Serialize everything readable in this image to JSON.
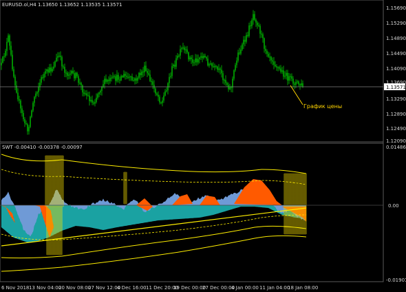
{
  "window": {
    "symbol_info": "EURUSD.ol,H4  1.13650 1.13652 1.13535 1.13571",
    "annotation": "График цены"
  },
  "colors": {
    "background": "#000000",
    "bull_candle": "#00c800",
    "price_marker_bg": "#ffffff",
    "annotation": "#ffd400",
    "swt_orange": "#ff5a00",
    "swt_blue": "#6f9ad6",
    "swt_teal": "#20b4b4",
    "swt_yellow": "#ffee00",
    "grid": "#4a4a4a"
  },
  "price_panel": {
    "y_labels": [
      "1.15690",
      "1.15290",
      "1.14890",
      "1.14490",
      "1.14090",
      "1.13690",
      "1.13290",
      "1.12890",
      "1.12490",
      "1.12090"
    ],
    "current_price": "1.13571"
  },
  "indicator_panel": {
    "title": "SWT -0.00410 -0.00378 -0.00097",
    "y_labels": [
      "0.01486",
      "0.00",
      "-0.01901"
    ]
  },
  "time_axis": {
    "labels": [
      "6 Nov 2018",
      "13 Nov 04:00",
      "20 Nov 08:00",
      "27 Nov 12:00",
      "4 Dec 16:00",
      "11 Dec 20:00",
      "19 Dec 00:00",
      "27 Dec 00:00",
      "4 Jan 00:00",
      "11 Jan 04:00",
      "18 Jan 08:00"
    ]
  }
}
